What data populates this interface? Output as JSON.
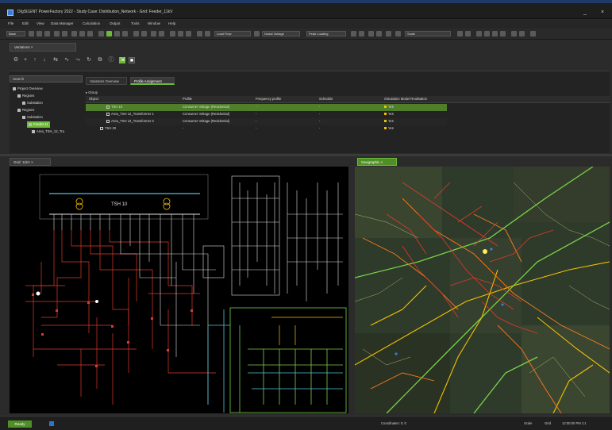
{
  "window": {
    "title": "DIgSILENT PowerFactory 2022 - Study Case: Distribution_Network - Grid: Feeder_11kV",
    "minimize": "_",
    "close": "×"
  },
  "menu": [
    "File",
    "Edit",
    "View",
    "Data Manager",
    "Calculation",
    "Output",
    "Tools",
    "Window",
    "Help"
  ],
  "toolbar": {
    "study_case": "Base",
    "combo_a": "Load Flow",
    "combo_b": "Nodal Voltage",
    "combo_c": "Peak Loading",
    "combo_d": "Scale"
  },
  "upper_tab": "Variations ×",
  "upper_panel": {
    "search_placeholder": "Search",
    "tree": [
      {
        "label": "Project Overview",
        "indent": 0
      },
      {
        "label": "Regions",
        "indent": 1
      },
      {
        "label": "Substation",
        "indent": 2
      },
      {
        "label": "Regions",
        "indent": 1
      },
      {
        "label": "Substation",
        "indent": 2
      },
      {
        "label": "Feeder 11",
        "indent": 3,
        "selected": true
      },
      {
        "label": "Area_TSH_12_Tra",
        "indent": 4
      }
    ],
    "subtabs": [
      "Variations Overview",
      "Profile Assignment"
    ],
    "group_label": "Group",
    "headers": [
      "Object",
      "Profile",
      "Frequency profile",
      "Schedule",
      "Simulation Model Realisation"
    ],
    "rows": [
      {
        "object": "TSH 10",
        "profile": "Consumer Voltage (Residential)",
        "freq": "-",
        "schedule": "-",
        "sim": "Yes",
        "selected": true
      },
      {
        "object": "Area_TSH 12_Transformer 1",
        "profile": "Consumer Voltage (Residential)",
        "freq": "-",
        "schedule": "-",
        "sim": "Yes"
      },
      {
        "object": "Area_TSH 12_Transformer 2",
        "profile": "Consumer Voltage (Residential)",
        "freq": "-",
        "schedule": "-",
        "sim": "Yes"
      },
      {
        "object": "TSH 20",
        "profile": "-",
        "freq": "-",
        "schedule": "-",
        "sim": "Yes"
      }
    ]
  },
  "schematic": {
    "tab_label": "Grid: 11kV ×",
    "busbar_label": "TSH 10"
  },
  "map": {
    "tab_label": "Geographic ×"
  },
  "statusbar": {
    "button": "Ready",
    "coords": "Coordinates: 0; 0",
    "right_a": "Scale",
    "right_b": "Grid",
    "right_c": "12:00:00 PM 1:1"
  },
  "colors": {
    "accent": "#6fb83a",
    "network_red": "#e03a2a",
    "network_yellow": "#f2c200",
    "network_orange": "#ff7a1a",
    "network_green": "#7ad14a"
  }
}
